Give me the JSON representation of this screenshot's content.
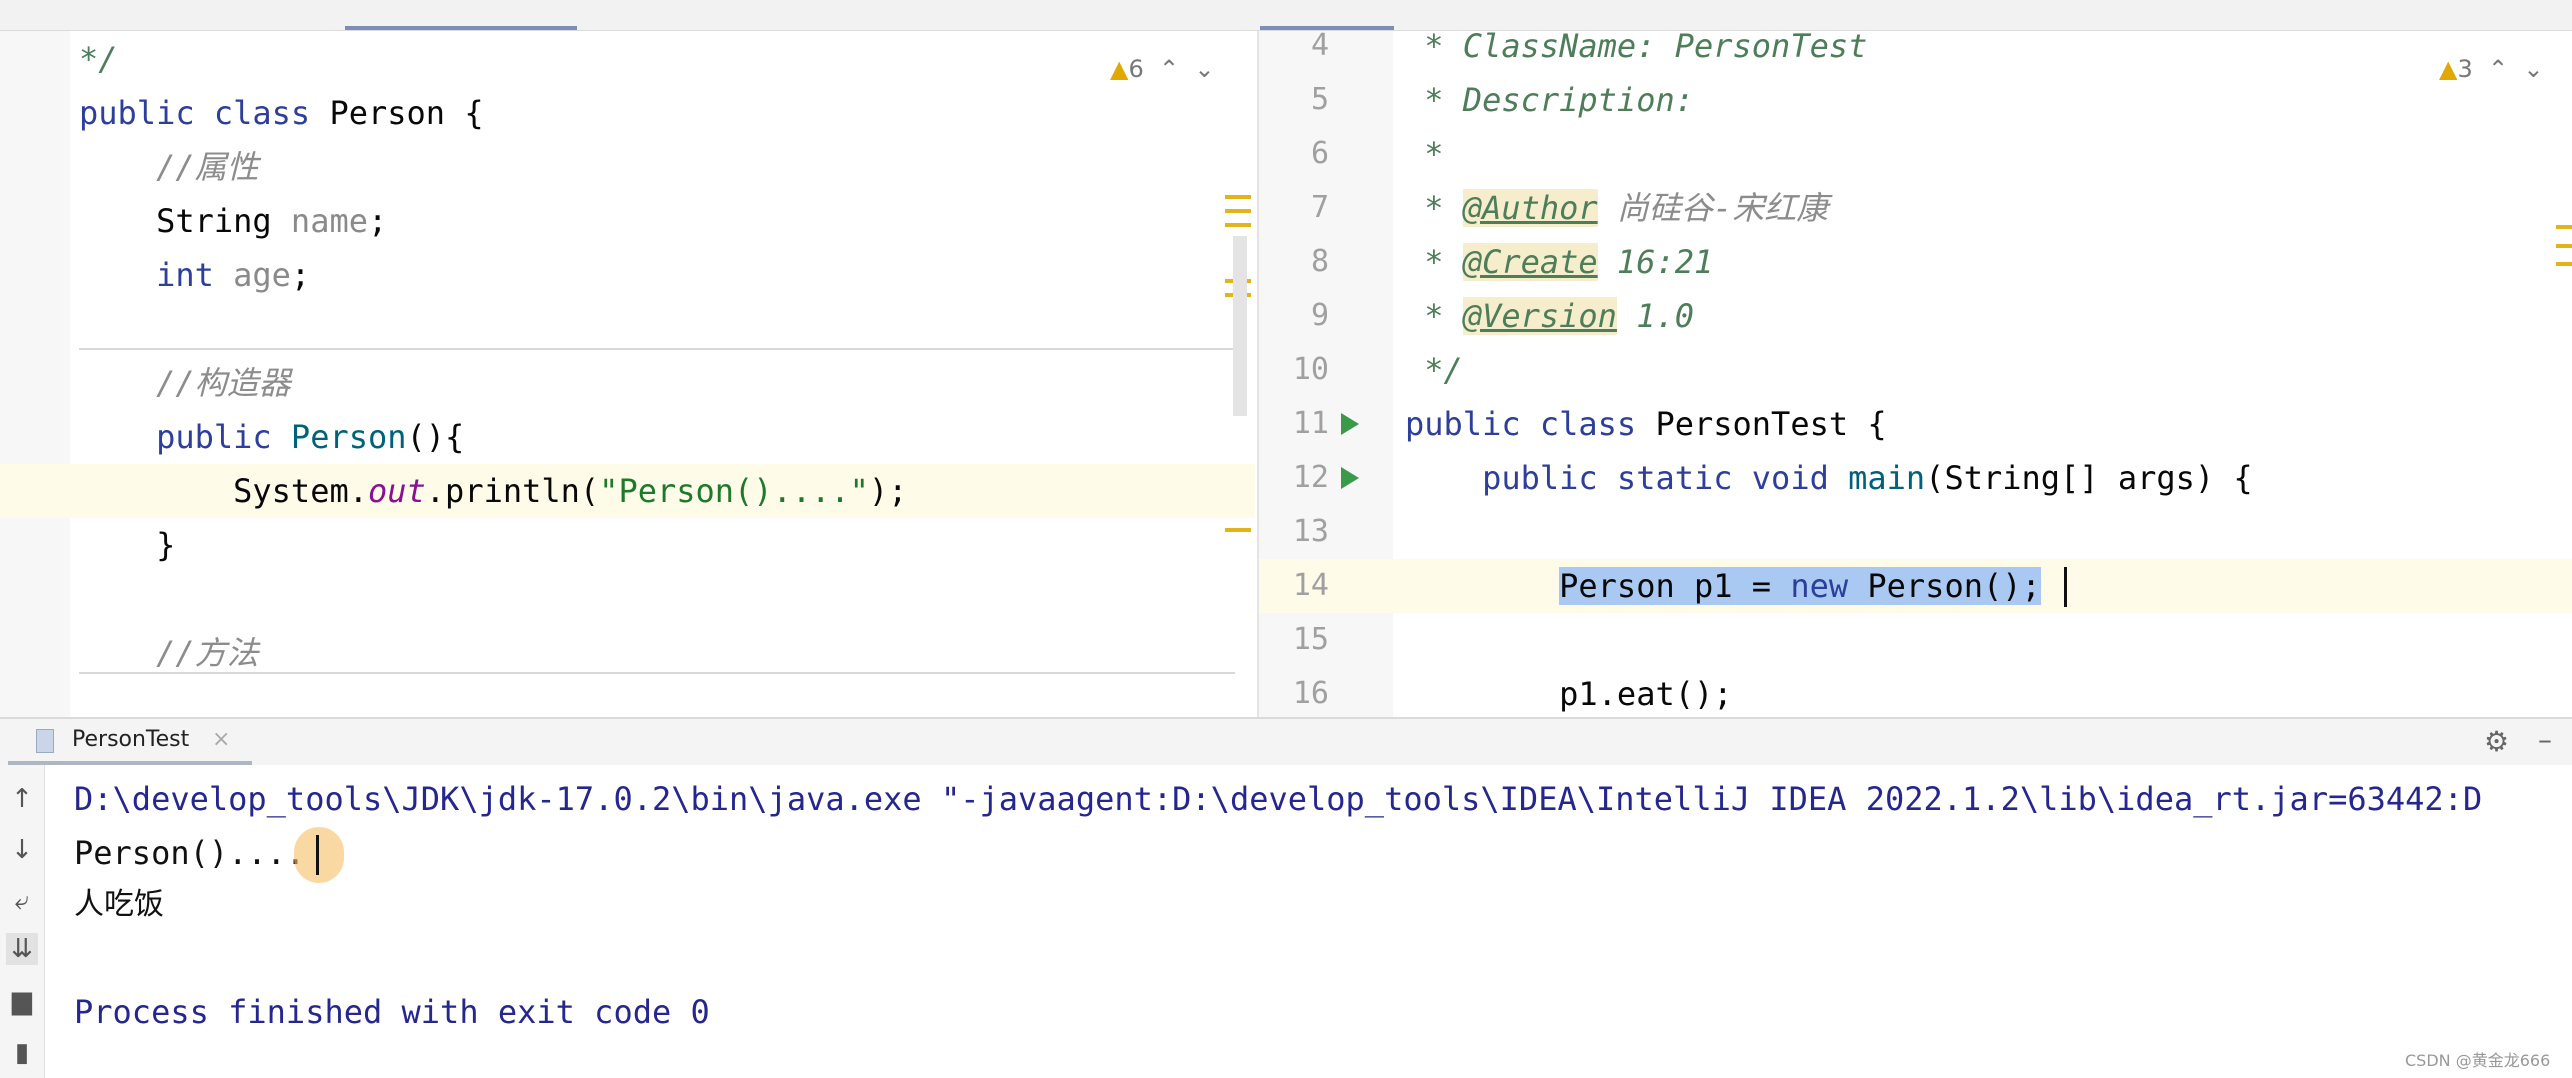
{
  "left_editor": {
    "warnings": {
      "icon": "warning-icon",
      "count": "6"
    },
    "lines": [
      [
        [
          "*/",
          "doc"
        ]
      ],
      [
        [
          "public ",
          "kw"
        ],
        [
          "class ",
          "kw"
        ],
        [
          "Person {",
          ""
        ]
      ],
      [
        [
          "    ",
          ""
        ],
        [
          "//属性",
          "cm"
        ]
      ],
      [
        [
          "    String ",
          ""
        ],
        [
          "name",
          "unused"
        ],
        [
          ";",
          ""
        ]
      ],
      [
        [
          "    ",
          ""
        ],
        [
          "int ",
          "kw"
        ],
        [
          "age",
          "unused"
        ],
        [
          ";",
          ""
        ]
      ],
      [],
      [
        [
          "    ",
          ""
        ],
        [
          "//构造器",
          "cm"
        ]
      ],
      [
        [
          "    ",
          ""
        ],
        [
          "public ",
          "kw"
        ],
        [
          "Person",
          "fn"
        ],
        [
          "(){",
          ""
        ]
      ],
      [
        [
          "        System.",
          ""
        ],
        [
          "out",
          "fld"
        ],
        [
          ".println(",
          ""
        ],
        [
          "\"Person()....\"",
          "str"
        ],
        [
          ");",
          ""
        ]
      ],
      [
        [
          "    }",
          ""
        ]
      ],
      [],
      [
        [
          "    ",
          ""
        ],
        [
          "//方法",
          "cm"
        ]
      ]
    ]
  },
  "right_editor": {
    "warnings": {
      "icon": "warning-icon",
      "count": "3"
    },
    "line_numbers": [
      "4",
      "5",
      "6",
      "7",
      "8",
      "9",
      "10",
      "11",
      "12",
      "13",
      "14",
      "15",
      "16"
    ],
    "run_lines": [
      "11",
      "12"
    ],
    "lines": [
      [
        [
          " * ClassName: PersonTest",
          "doc"
        ]
      ],
      [
        [
          " * Description:",
          "doc"
        ]
      ],
      [
        [
          " *",
          "doc"
        ]
      ],
      [
        [
          " * ",
          "doc"
        ],
        [
          "@Author",
          "tag"
        ],
        [
          " 尚硅谷-宋红康",
          "cm"
        ]
      ],
      [
        [
          " * ",
          "doc"
        ],
        [
          "@Create",
          "tag"
        ],
        [
          " 16:21",
          "doc"
        ]
      ],
      [
        [
          " * ",
          "doc"
        ],
        [
          "@Version",
          "tag"
        ],
        [
          " 1.0",
          "doc"
        ]
      ],
      [
        [
          " */",
          "doc"
        ]
      ],
      [
        [
          "public ",
          "kw"
        ],
        [
          "class ",
          "kw"
        ],
        [
          "PersonTest {",
          ""
        ]
      ],
      [
        [
          "    ",
          ""
        ],
        [
          "public ",
          "kw"
        ],
        [
          "static ",
          "kw"
        ],
        [
          "void ",
          "kw"
        ],
        [
          "main",
          "fn"
        ],
        [
          "(String[] args) {",
          ""
        ]
      ],
      [],
      [
        [
          "        ",
          ""
        ],
        [
          "Person p1 = ",
          "sel"
        ],
        [
          "new ",
          "kw sel"
        ],
        [
          "Person();",
          "sel"
        ]
      ],
      [],
      [
        [
          "        p1.eat();",
          ""
        ]
      ]
    ]
  },
  "console": {
    "tab_label": "PersonTest",
    "command": "D:\\develop_tools\\JDK\\jdk-17.0.2\\bin\\java.exe \"-javaagent:D:\\develop_tools\\IDEA\\IntelliJ IDEA 2022.1.2\\lib\\idea_rt.jar=63442:D",
    "output": [
      "Person()....",
      "人吃饭"
    ],
    "exit_message": "Process finished with exit code 0",
    "tools": [
      "arrow-up-icon",
      "arrow-down-icon",
      "soft-wrap-icon",
      "scroll-to-end-icon",
      "print-icon",
      "trash-icon"
    ]
  },
  "watermark": "CSDN @黄金龙666"
}
